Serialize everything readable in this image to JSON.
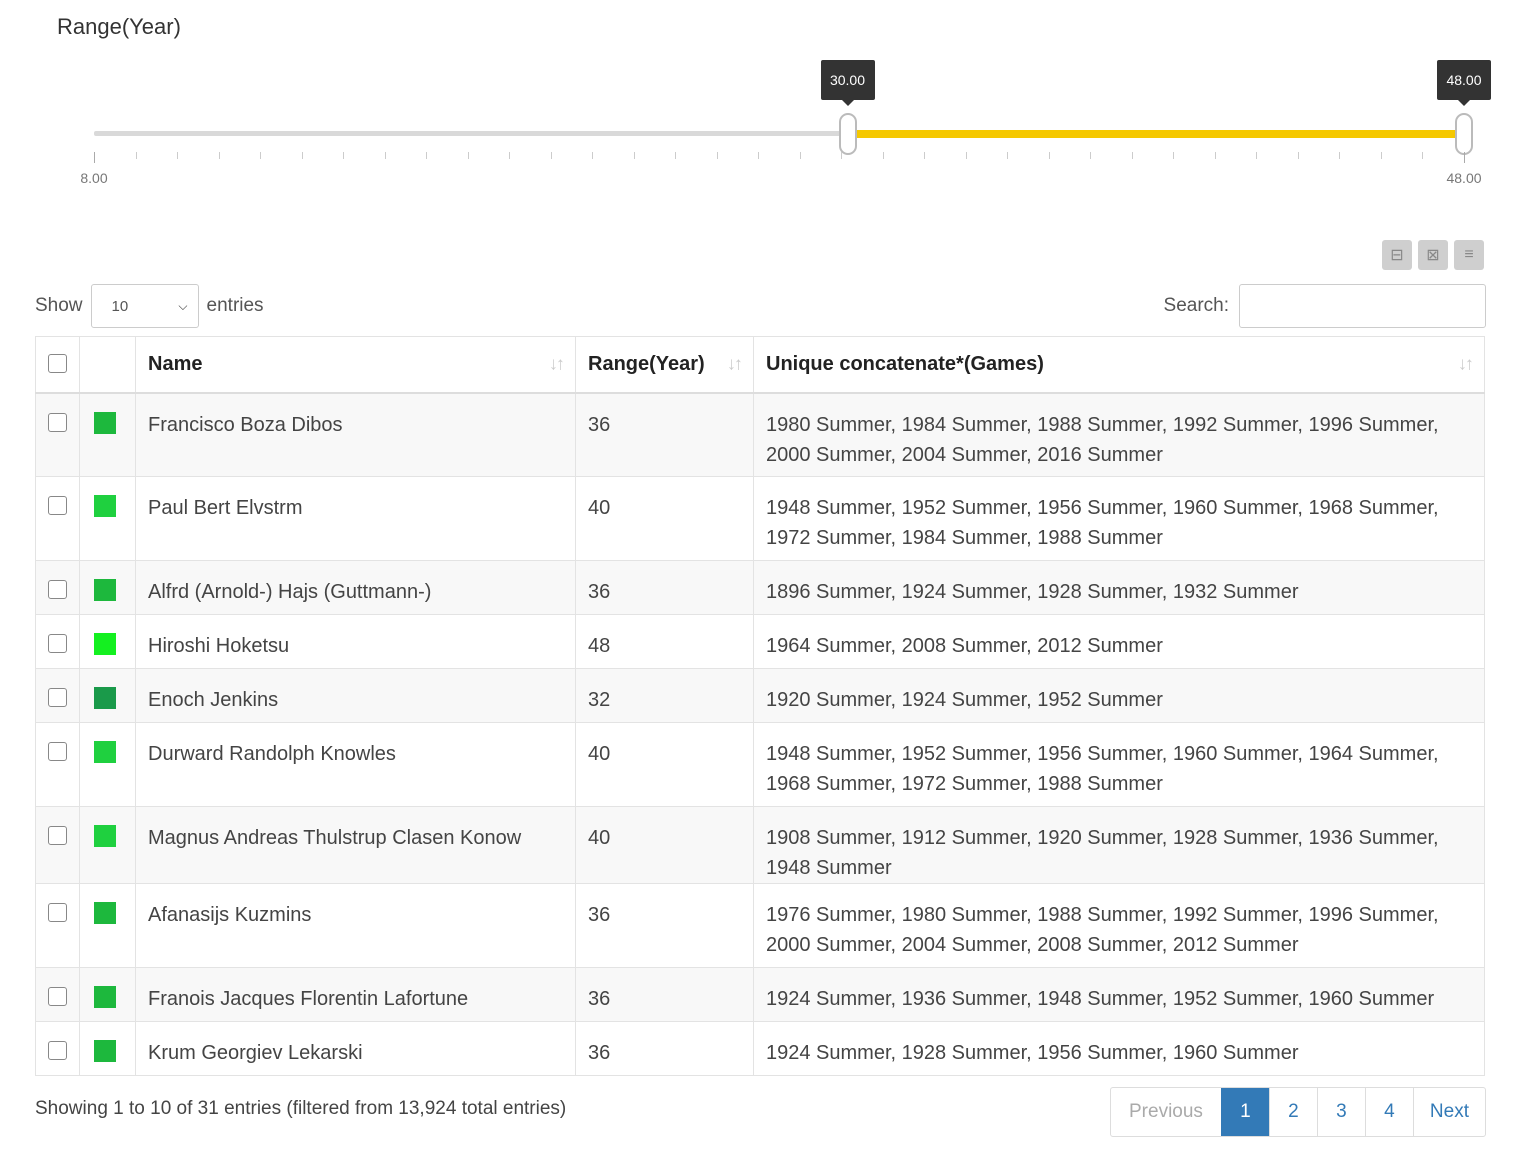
{
  "filter": {
    "title": "Range(Year)",
    "min": 8,
    "max": 48,
    "low": 30,
    "high": 48,
    "low_label": "30.00",
    "high_label": "48.00",
    "min_label": "8.00",
    "max_label": "48.00",
    "fill_color": "#f5c800"
  },
  "toolbar": {
    "icons": [
      "collapse-icon",
      "expand-icon",
      "list-icon"
    ]
  },
  "show": {
    "prefix": "Show",
    "value": "10",
    "suffix": "entries"
  },
  "search": {
    "label": "Search:",
    "value": ""
  },
  "table": {
    "headers": {
      "name": "Name",
      "range": "Range(Year)",
      "games": "Unique concatenate*(Games)"
    },
    "rows": [
      {
        "color": "#1db83d",
        "name": "Francisco Boza Dibos",
        "range": "36",
        "games": "1980 Summer, 1984 Summer, 1988 Summer, 1992 Summer, 1996 Summer, 2000 Summer, 2004 Summer, 2016 Summer"
      },
      {
        "color": "#1fd03f",
        "name": "Paul Bert Elvstrm",
        "range": "40",
        "games": "1948 Summer, 1952 Summer, 1956 Summer, 1960 Summer, 1968 Summer, 1972 Summer, 1984 Summer, 1988 Summer"
      },
      {
        "color": "#1db83d",
        "name": "Alfrd (Arnold-) Hajs (Guttmann-)",
        "range": "36",
        "games": "1896 Summer, 1924 Summer, 1928 Summer, 1932 Summer"
      },
      {
        "color": "#14f020",
        "name": "Hiroshi Hoketsu",
        "range": "48",
        "games": "1964 Summer, 2008 Summer, 2012 Summer"
      },
      {
        "color": "#1a9a4a",
        "name": "Enoch Jenkins",
        "range": "32",
        "games": "1920 Summer, 1924 Summer, 1952 Summer"
      },
      {
        "color": "#1fd03f",
        "name": "Durward Randolph Knowles",
        "range": "40",
        "games": "1948 Summer, 1952 Summer, 1956 Summer, 1960 Summer, 1964 Summer, 1968 Summer, 1972 Summer, 1988 Summer"
      },
      {
        "color": "#1fd03f",
        "name": "Magnus Andreas Thulstrup Clasen Konow",
        "range": "40",
        "games": "1908 Summer, 1912 Summer, 1920 Summer, 1928 Summer, 1936 Summer, 1948 Summer"
      },
      {
        "color": "#1db83d",
        "name": "Afanasijs Kuzmins",
        "range": "36",
        "games": "1976 Summer, 1980 Summer, 1988 Summer, 1992 Summer, 1996 Summer, 2000 Summer, 2004 Summer, 2008 Summer, 2012 Summer"
      },
      {
        "color": "#1db83d",
        "name": "Franois Jacques Florentin Lafortune",
        "range": "36",
        "games": "1924 Summer, 1936 Summer, 1948 Summer, 1952 Summer, 1960 Summer"
      },
      {
        "color": "#1db83d",
        "name": "Krum Georgiev Lekarski",
        "range": "36",
        "games": "1924 Summer, 1928 Summer, 1956 Summer, 1960 Summer"
      }
    ]
  },
  "info": "Showing 1 to 10 of 31 entries (filtered from 13,924 total entries)",
  "pagination": {
    "previous": "Previous",
    "pages": [
      "1",
      "2",
      "3",
      "4"
    ],
    "current": "1",
    "next": "Next"
  }
}
